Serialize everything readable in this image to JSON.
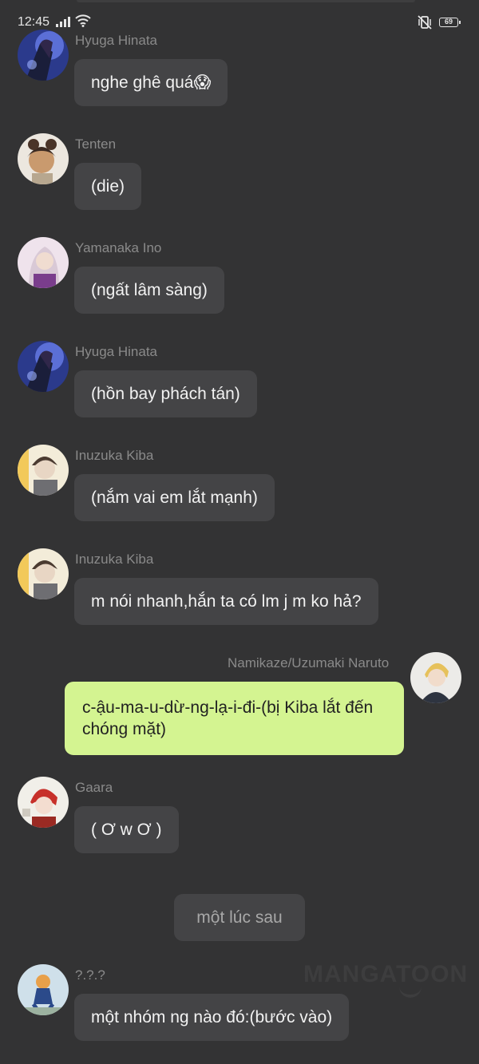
{
  "status_bar": {
    "time": "12:45",
    "battery": "69"
  },
  "messages": [
    {
      "sender": "Hyuga Hinata",
      "text": "nghe ghê quá😱"
    },
    {
      "sender": "Tenten",
      "text": "(die)"
    },
    {
      "sender": "Yamanaka Ino",
      "text": "(ngất lâm sàng)"
    },
    {
      "sender": "Hyuga Hinata",
      "text": "(hồn bay phách tán)"
    },
    {
      "sender": "Inuzuka Kiba",
      "text": "(nắm vai em lắt mạnh)"
    },
    {
      "sender": "Inuzuka Kiba",
      "text": "m nói nhanh,hắn ta có lm j m ko hả?"
    },
    {
      "sender": "Namikaze/Uzumaki Naruto",
      "text": "c-ậu-ma-u-dừ-ng-lạ-i-đi-(bị Kiba lắt đến chóng mặt)"
    },
    {
      "sender": "Gaara",
      "text": "( Ơ w Ơ )"
    },
    {
      "sender": "?.?.?",
      "text": "một nhóm ng nào đó:(bước vào)"
    }
  ],
  "system_note": "một lúc sau",
  "watermark": "MANGATOON",
  "colors": {
    "background": "#333334",
    "bubble": "#444446",
    "own_bubble": "#d4f491",
    "sender_name": "#8a8a8a"
  }
}
